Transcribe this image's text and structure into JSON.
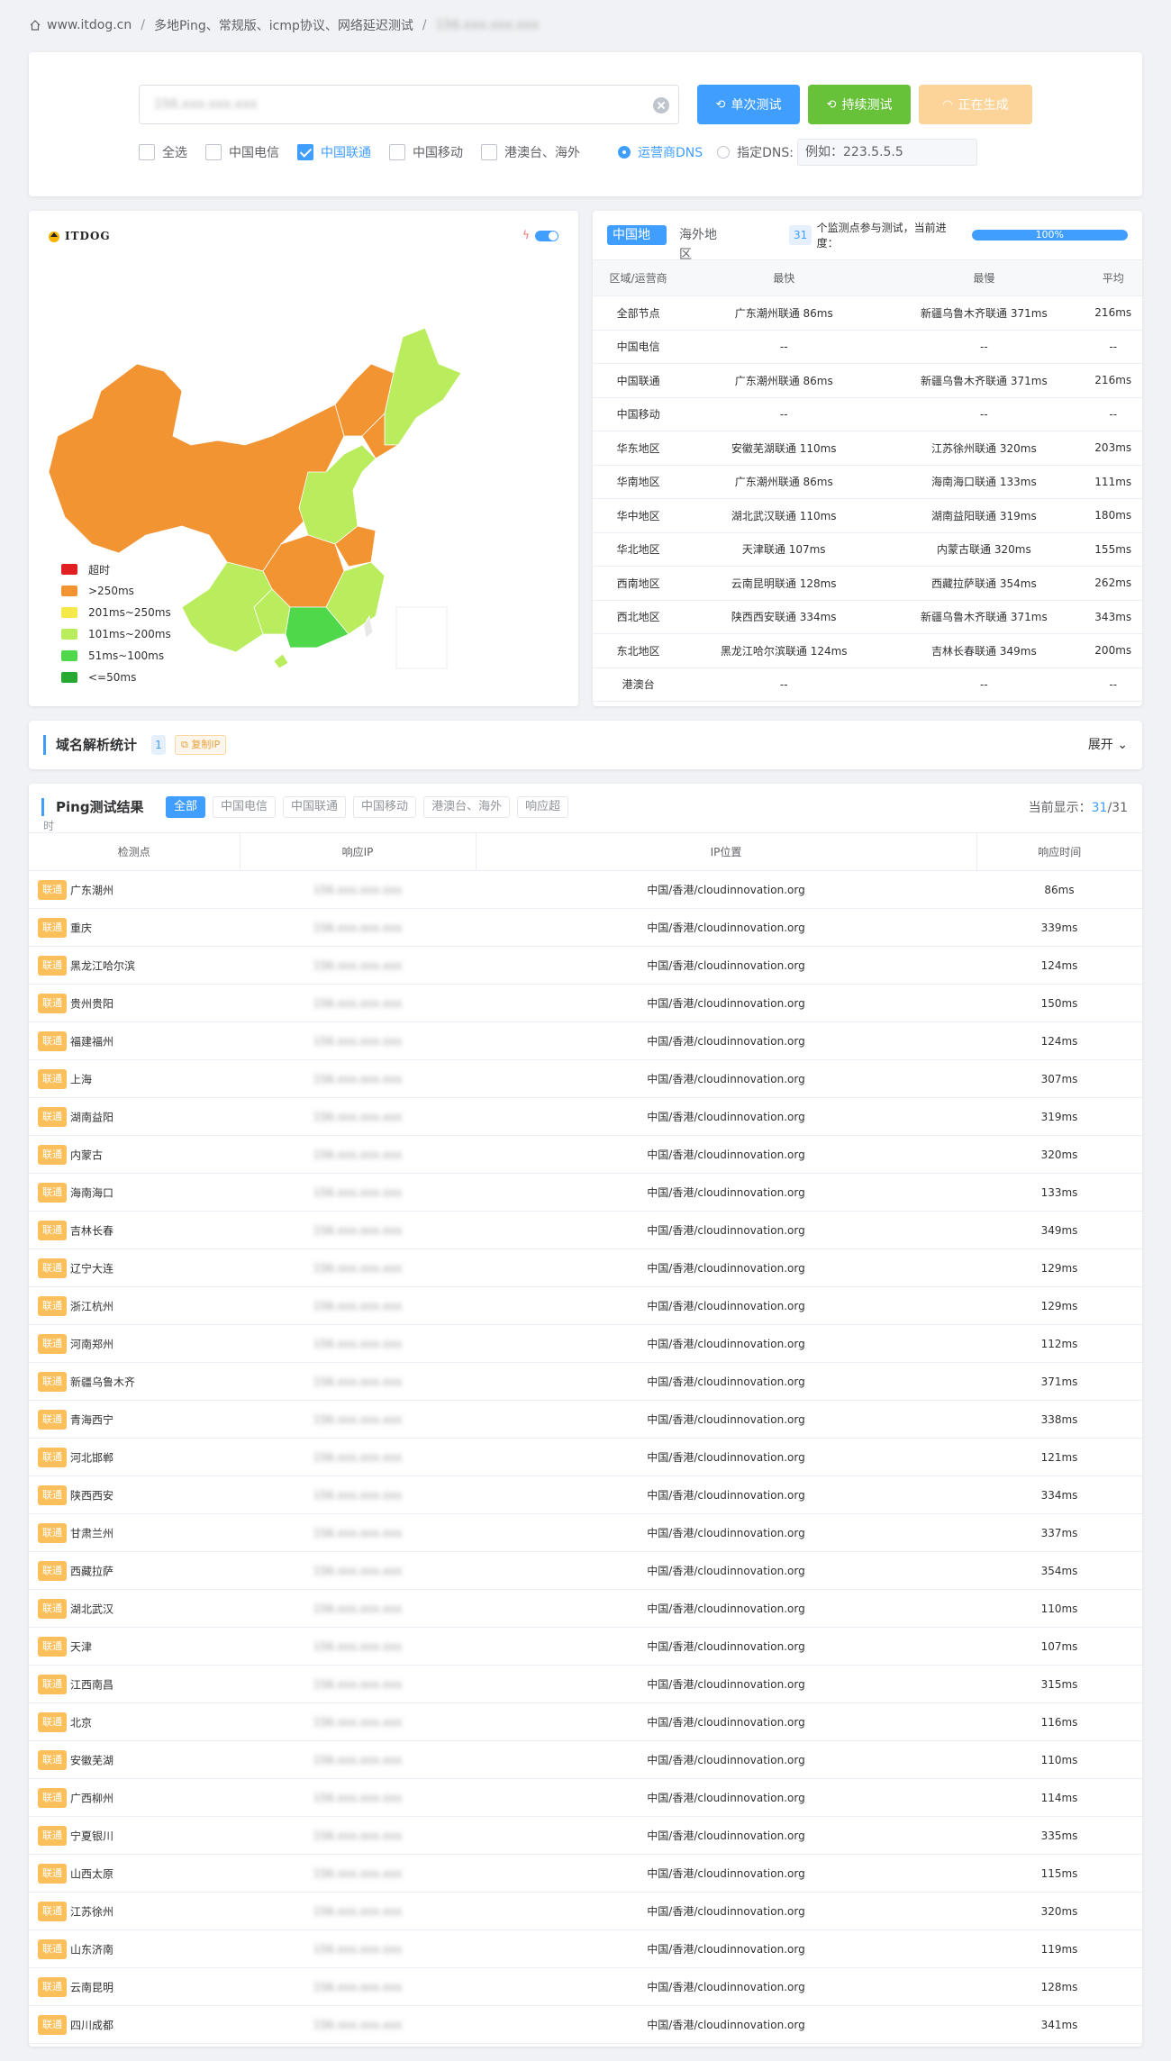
{
  "breadcrumb": {
    "home": "www.itdog.cn",
    "page": "多地Ping、常规版、icmp协议、网络延迟测试",
    "current": "156.xxx.xxx.xxx"
  },
  "search": {
    "value": "156.xxx.xxx.xxx",
    "btn_single": "单次测试",
    "btn_continuous": "持续测试",
    "btn_generating": "正在生成",
    "checkboxes": [
      {
        "label": "全选",
        "checked": false
      },
      {
        "label": "中国电信",
        "checked": false
      },
      {
        "label": "中国联通",
        "checked": true
      },
      {
        "label": "中国移动",
        "checked": false
      },
      {
        "label": "港澳台、海外",
        "checked": false
      }
    ],
    "dns_operator": "运营商DNS",
    "dns_custom": "指定DNS:",
    "dns_placeholder": "例如：223.5.5.5"
  },
  "map": {
    "logo": "ITDOG",
    "legend": [
      {
        "label": "超时",
        "color": "#e02020"
      },
      {
        "label": ">250ms",
        "color": "#f39433"
      },
      {
        "label": "201ms~250ms",
        "color": "#f5e94a"
      },
      {
        "label": "101ms~200ms",
        "color": "#b9ed5e"
      },
      {
        "label": "51ms~100ms",
        "color": "#4ed84a"
      },
      {
        "label": "<=50ms",
        "color": "#27a830"
      }
    ]
  },
  "stats": {
    "tab_china": "中国地区",
    "tab_overseas": "海外地区",
    "node_count": "31",
    "progress_label": "个监测点参与测试，当前进度：",
    "progress_value": "100%",
    "progress_fraction": 1.0,
    "headers": [
      "区域/运营商",
      "最快",
      "最慢",
      "平均"
    ],
    "rows": [
      [
        "全部节点",
        "广东潮州联通 86ms",
        "新疆乌鲁木齐联通 371ms",
        "216ms"
      ],
      [
        "中国电信",
        "--",
        "--",
        "--"
      ],
      [
        "中国联通",
        "广东潮州联通 86ms",
        "新疆乌鲁木齐联通 371ms",
        "216ms"
      ],
      [
        "中国移动",
        "--",
        "--",
        "--"
      ],
      [
        "华东地区",
        "安徽芜湖联通 110ms",
        "江苏徐州联通 320ms",
        "203ms"
      ],
      [
        "华南地区",
        "广东潮州联通 86ms",
        "海南海口联通 133ms",
        "111ms"
      ],
      [
        "华中地区",
        "湖北武汉联通 110ms",
        "湖南益阳联通 319ms",
        "180ms"
      ],
      [
        "华北地区",
        "天津联通 107ms",
        "内蒙古联通 320ms",
        "155ms"
      ],
      [
        "西南地区",
        "云南昆明联通 128ms",
        "西藏拉萨联通 354ms",
        "262ms"
      ],
      [
        "西北地区",
        "陕西西安联通 334ms",
        "新疆乌鲁木齐联通 371ms",
        "343ms"
      ],
      [
        "东北地区",
        "黑龙江哈尔滨联通 124ms",
        "吉林长春联通 349ms",
        "200ms"
      ],
      [
        "港澳台",
        "--",
        "--",
        "--"
      ]
    ]
  },
  "domain": {
    "title": "域名解析统计",
    "count": "1",
    "copy_ip": "复制IP",
    "expand": "展开"
  },
  "results": {
    "title": "Ping测试结果",
    "title_tail": "时",
    "filters": [
      "全部",
      "中国电信",
      "中国联通",
      "中国移动",
      "港澳台、海外",
      "响应超"
    ],
    "shown_label": "当前显示：",
    "shown_current": "31",
    "shown_total": "/31",
    "headers": [
      "检测点",
      "响应IP",
      "IP位置",
      "响应时间"
    ],
    "isp_tag": "联通",
    "ip_placeholder": "156.xxx.xxx.xxx",
    "rows": [
      {
        "node": "广东潮州",
        "loc": "中国/香港/cloudinnovation.org",
        "time": "86ms"
      },
      {
        "node": "重庆",
        "loc": "中国/香港/cloudinnovation.org",
        "time": "339ms"
      },
      {
        "node": "黑龙江哈尔滨",
        "loc": "中国/香港/cloudinnovation.org",
        "time": "124ms"
      },
      {
        "node": "贵州贵阳",
        "loc": "中国/香港/cloudinnovation.org",
        "time": "150ms"
      },
      {
        "node": "福建福州",
        "loc": "中国/香港/cloudinnovation.org",
        "time": "124ms"
      },
      {
        "node": "上海",
        "loc": "中国/香港/cloudinnovation.org",
        "time": "307ms"
      },
      {
        "node": "湖南益阳",
        "loc": "中国/香港/cloudinnovation.org",
        "time": "319ms"
      },
      {
        "node": "内蒙古",
        "loc": "中国/香港/cloudinnovation.org",
        "time": "320ms"
      },
      {
        "node": "海南海口",
        "loc": "中国/香港/cloudinnovation.org",
        "time": "133ms"
      },
      {
        "node": "吉林长春",
        "loc": "中国/香港/cloudinnovation.org",
        "time": "349ms"
      },
      {
        "node": "辽宁大连",
        "loc": "中国/香港/cloudinnovation.org",
        "time": "129ms"
      },
      {
        "node": "浙江杭州",
        "loc": "中国/香港/cloudinnovation.org",
        "time": "129ms"
      },
      {
        "node": "河南郑州",
        "loc": "中国/香港/cloudinnovation.org",
        "time": "112ms"
      },
      {
        "node": "新疆乌鲁木齐",
        "loc": "中国/香港/cloudinnovation.org",
        "time": "371ms"
      },
      {
        "node": "青海西宁",
        "loc": "中国/香港/cloudinnovation.org",
        "time": "338ms"
      },
      {
        "node": "河北邯郸",
        "loc": "中国/香港/cloudinnovation.org",
        "time": "121ms"
      },
      {
        "node": "陕西西安",
        "loc": "中国/香港/cloudinnovation.org",
        "time": "334ms"
      },
      {
        "node": "甘肃兰州",
        "loc": "中国/香港/cloudinnovation.org",
        "time": "337ms"
      },
      {
        "node": "西藏拉萨",
        "loc": "中国/香港/cloudinnovation.org",
        "time": "354ms"
      },
      {
        "node": "湖北武汉",
        "loc": "中国/香港/cloudinnovation.org",
        "time": "110ms"
      },
      {
        "node": "天津",
        "loc": "中国/香港/cloudinnovation.org",
        "time": "107ms"
      },
      {
        "node": "江西南昌",
        "loc": "中国/香港/cloudinnovation.org",
        "time": "315ms"
      },
      {
        "node": "北京",
        "loc": "中国/香港/cloudinnovation.org",
        "time": "116ms"
      },
      {
        "node": "安徽芜湖",
        "loc": "中国/香港/cloudinnovation.org",
        "time": "110ms"
      },
      {
        "node": "广西柳州",
        "loc": "中国/香港/cloudinnovation.org",
        "time": "114ms"
      },
      {
        "node": "宁夏银川",
        "loc": "中国/香港/cloudinnovation.org",
        "time": "335ms"
      },
      {
        "node": "山西太原",
        "loc": "中国/香港/cloudinnovation.org",
        "time": "115ms"
      },
      {
        "node": "江苏徐州",
        "loc": "中国/香港/cloudinnovation.org",
        "time": "320ms"
      },
      {
        "node": "山东济南",
        "loc": "中国/香港/cloudinnovation.org",
        "time": "119ms"
      },
      {
        "node": "云南昆明",
        "loc": "中国/香港/cloudinnovation.org",
        "time": "128ms"
      },
      {
        "node": "四川成都",
        "loc": "中国/香港/cloudinnovation.org",
        "time": "341ms"
      }
    ]
  }
}
